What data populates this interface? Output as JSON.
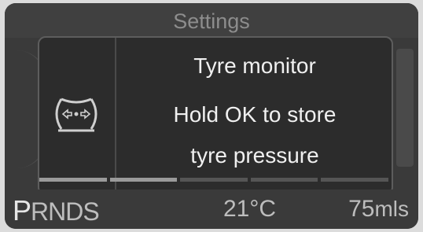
{
  "header": {
    "title": "Settings"
  },
  "dialog": {
    "icon": "tyre-pressure-icon",
    "title": "Tyre monitor",
    "message_line1": "Hold OK to store",
    "message_line2": "tyre pressure",
    "progress_segments_total": 5,
    "progress_segments_filled": 2
  },
  "status_bar": {
    "gear_selected": "P",
    "gear_rest": "RNDS",
    "temperature": "21°C",
    "range_value": "75",
    "range_unit": "mls"
  },
  "colors": {
    "background": "#3a3a3a",
    "dialog": "#2c2c2c",
    "text": "#f0f0f0",
    "muted_text": "#8d8d8d"
  }
}
